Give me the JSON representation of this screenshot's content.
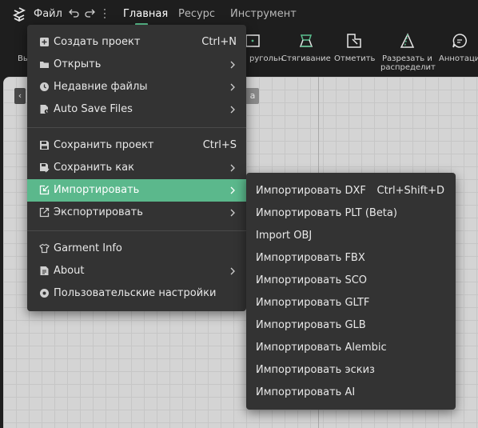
{
  "header": {
    "file_menu_label": "Файл",
    "tabs": [
      {
        "label": "Главная",
        "active": true
      },
      {
        "label": "Ресурс",
        "active": false
      },
      {
        "label": "Инструмент",
        "active": false
      }
    ],
    "accent_color": "#5bbf8f"
  },
  "toolbar": {
    "items": [
      {
        "label": "Вы",
        "icon": "select-icon"
      },
      {
        "label": "ругольн",
        "icon": "rectangle-icon"
      },
      {
        "label": "Стягивание",
        "icon": "stretch-icon"
      },
      {
        "label": "Отметить",
        "icon": "mark-icon"
      },
      {
        "label": "Разрезать и",
        "label2": "распределит",
        "icon": "cut-distribute-icon"
      },
      {
        "label": "Аннотаци",
        "icon": "annotation-icon"
      }
    ]
  },
  "canvas": {
    "left_button": "‹",
    "chip_text": "а"
  },
  "file_menu": {
    "items": [
      {
        "label": "Создать проект",
        "shortcut": "Ctrl+N",
        "icon": "new-project-icon",
        "submenu": false
      },
      {
        "label": "Открыть",
        "shortcut": "",
        "icon": "folder-icon",
        "submenu": true
      },
      {
        "label": "Недавние файлы",
        "shortcut": "",
        "icon": "clock-icon",
        "submenu": true
      },
      {
        "label": "Auto Save Files",
        "shortcut": "",
        "icon": "autosave-icon",
        "submenu": true
      },
      {
        "label": "Сохранить проект",
        "shortcut": "Ctrl+S",
        "icon": "save-icon",
        "submenu": false
      },
      {
        "label": "Сохранить как",
        "shortcut": "",
        "icon": "save-as-icon",
        "submenu": true
      },
      {
        "label": "Импортировать",
        "shortcut": "",
        "icon": "import-icon",
        "submenu": true,
        "highlighted": true
      },
      {
        "label": "Экспортировать",
        "shortcut": "",
        "icon": "export-icon",
        "submenu": true
      },
      {
        "label": "Garment Info",
        "shortcut": "",
        "icon": "garment-icon",
        "submenu": false
      },
      {
        "label": "About",
        "shortcut": "",
        "icon": "info-icon",
        "submenu": true
      },
      {
        "label": "Пользовательские настройки",
        "shortcut": "",
        "icon": "settings-icon",
        "submenu": false
      }
    ]
  },
  "import_submenu": {
    "items": [
      {
        "label": "Импортировать DXF",
        "shortcut": "Ctrl+Shift+D"
      },
      {
        "label": "Импортировать PLT (Beta)",
        "shortcut": ""
      },
      {
        "label": "Import OBJ",
        "shortcut": ""
      },
      {
        "label": "Импортировать FBX",
        "shortcut": ""
      },
      {
        "label": "Импортировать SCO",
        "shortcut": ""
      },
      {
        "label": "Импортировать GLTF",
        "shortcut": ""
      },
      {
        "label": "Импортировать GLB",
        "shortcut": ""
      },
      {
        "label": "Импортировать Alembic",
        "shortcut": ""
      },
      {
        "label": "Импортировать эскиз",
        "shortcut": ""
      },
      {
        "label": "Импортировать AI",
        "shortcut": ""
      }
    ]
  }
}
